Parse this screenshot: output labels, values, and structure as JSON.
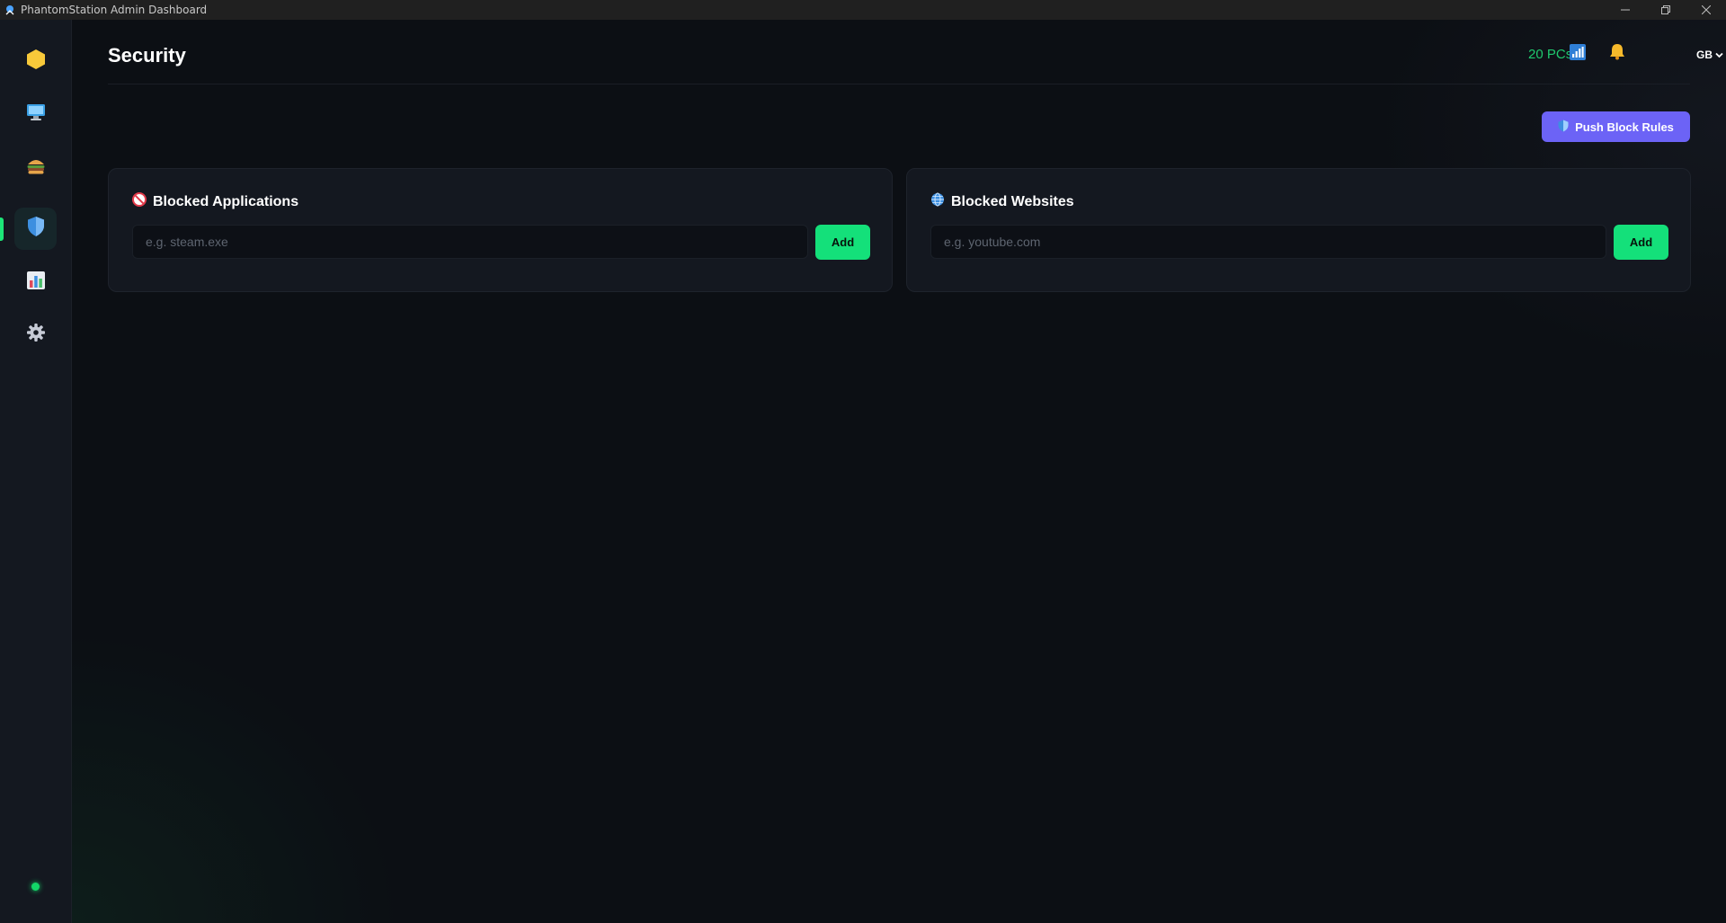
{
  "window": {
    "title": "PhantomStation Admin Dashboard",
    "controls": [
      "minimize",
      "restore",
      "close"
    ]
  },
  "sidebar": {
    "items": [
      {
        "key": "logo",
        "icon": "hexagon-logo-icon",
        "active": false
      },
      {
        "key": "pcs",
        "icon": "monitor-icon",
        "active": false
      },
      {
        "key": "food",
        "icon": "burger-icon",
        "active": false
      },
      {
        "key": "security",
        "icon": "shield-icon",
        "active": true
      },
      {
        "key": "reports",
        "icon": "bar-chart-icon",
        "active": false
      },
      {
        "key": "settings",
        "icon": "gear-icon",
        "active": false
      }
    ],
    "status": "online"
  },
  "header": {
    "title": "Security",
    "pc_count": "20 PCs",
    "language": "GB"
  },
  "actions": {
    "push_label": "Push Block Rules"
  },
  "cards": {
    "apps": {
      "title": "Blocked Applications",
      "icon": "no-entry-icon",
      "placeholder": "e.g. steam.exe",
      "value": "",
      "button": "Add"
    },
    "sites": {
      "title": "Blocked Websites",
      "icon": "globe-icon",
      "placeholder": "e.g. youtube.com",
      "value": "",
      "button": "Add"
    }
  },
  "colors": {
    "accent_green": "#14e07a",
    "accent_purple": "#6c63f6",
    "background": "#0c0f14",
    "sidebar": "#141820"
  }
}
